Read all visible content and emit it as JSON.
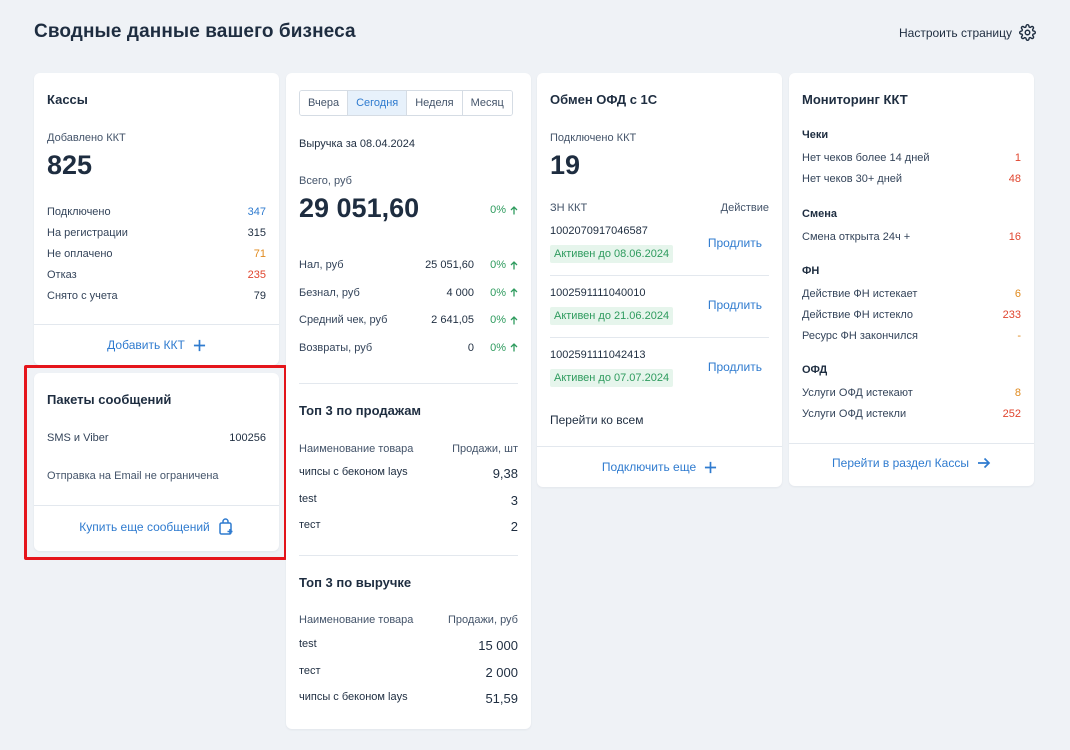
{
  "header": {
    "title": "Сводные данные вашего бизнеса",
    "configure_label": "Настроить страницу"
  },
  "kassy": {
    "title": "Кассы",
    "added_label": "Добавлено ККТ",
    "added_value": "825",
    "stats": [
      {
        "label": "Подключено",
        "value": "347",
        "color": "#2f7bcf"
      },
      {
        "label": "На регистрации",
        "value": "315",
        "color": "#1e2d40"
      },
      {
        "label": "Не оплачено",
        "value": "71",
        "color": "#e08a1e"
      },
      {
        "label": "Отказ",
        "value": "235",
        "color": "#e0452e"
      },
      {
        "label": "Снято с учета",
        "value": "79",
        "color": "#1e2d40"
      }
    ],
    "add_label": "Добавить ККТ"
  },
  "messages": {
    "title": "Пакеты сообщений",
    "sms_label": "SMS и Viber",
    "sms_value": "100256",
    "email_text": "Отправка на Email не ограничена",
    "buy_label": "Купить еще сообщений"
  },
  "revenue": {
    "tabs": [
      "Вчера",
      "Сегодня",
      "Неделя",
      "Месяц"
    ],
    "active_tab": "Сегодня",
    "date_label": "Выручка за 08.04.2024",
    "total_label": "Всего, руб",
    "total_value": "29 051,60",
    "total_pct": "0%",
    "metrics": [
      {
        "label": "Нал, руб",
        "value": "25 051,60",
        "pct": "0%"
      },
      {
        "label": "Безнал, руб",
        "value": "4 000",
        "pct": "0%"
      },
      {
        "label": "Средний чек, руб",
        "value": "2 641,05",
        "pct": "0%"
      },
      {
        "label": "Возвраты, руб",
        "value": "0",
        "pct": "0%"
      }
    ],
    "top_sales": {
      "title": "Топ 3 по продажам",
      "col1": "Наименование товара",
      "col2": "Продажи, шт",
      "rows": [
        {
          "name": "чипсы с беконом lays",
          "value": "9,38"
        },
        {
          "name": "test",
          "value": "3"
        },
        {
          "name": "тест",
          "value": "2"
        }
      ]
    },
    "top_revenue": {
      "title": "Топ 3 по выручке",
      "col1": "Наименование товара",
      "col2": "Продажи, руб",
      "rows": [
        {
          "name": "test",
          "value": "15 000"
        },
        {
          "name": "тест",
          "value": "2 000"
        },
        {
          "name": "чипсы с беконом lays",
          "value": "51,59"
        }
      ]
    }
  },
  "ofd": {
    "title": "Обмен ОФД с 1С",
    "connected_label": "Подключено ККТ",
    "connected_value": "19",
    "col_zn": "ЗН ККТ",
    "col_action": "Действие",
    "items": [
      {
        "zn": "1002070917046587",
        "status": "Активен до 08.06.2024",
        "action": "Продлить"
      },
      {
        "zn": "1002591111040010",
        "status": "Активен до 21.06.2024",
        "action": "Продлить"
      },
      {
        "zn": "1002591111042413",
        "status": "Активен до 07.07.2024",
        "action": "Продлить"
      }
    ],
    "all_label": "Перейти ко всем",
    "connect_label": "Подключить еще"
  },
  "monitoring": {
    "title": "Мониторинг ККТ",
    "sections": [
      {
        "title": "Чеки",
        "rows": [
          {
            "label": "Нет чеков более 14 дней",
            "value": "1",
            "color": "#e0452e"
          },
          {
            "label": "Нет чеков 30+ дней",
            "value": "48",
            "color": "#e0452e"
          }
        ]
      },
      {
        "title": "Смена",
        "rows": [
          {
            "label": "Смена открыта 24ч +",
            "value": "16",
            "color": "#e0452e"
          }
        ]
      },
      {
        "title": "ФН",
        "rows": [
          {
            "label": "Действие ФН истекает",
            "value": "6",
            "color": "#e08a1e"
          },
          {
            "label": "Действие ФН истекло",
            "value": "233",
            "color": "#e0452e"
          },
          {
            "label": "Ресурс ФН закончился",
            "value": "-",
            "color": "#e08a1e"
          }
        ]
      },
      {
        "title": "ОФД",
        "rows": [
          {
            "label": "Услуги ОФД истекают",
            "value": "8",
            "color": "#e08a1e"
          },
          {
            "label": "Услуги ОФД истекли",
            "value": "252",
            "color": "#e0452e"
          }
        ]
      }
    ],
    "go_label": "Перейти в раздел Кассы"
  }
}
